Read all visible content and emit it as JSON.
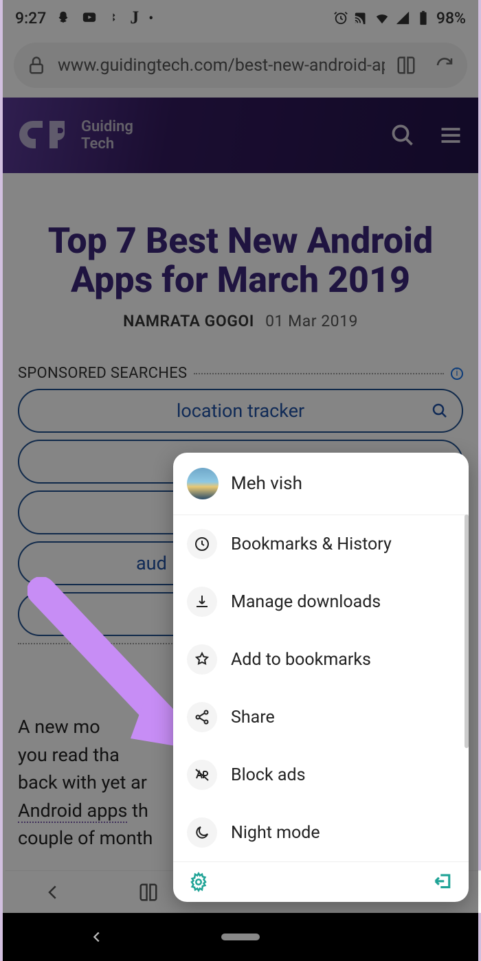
{
  "status": {
    "time": "9:27",
    "battery": "98%"
  },
  "url": "www.guidingtech.com/best-new-android-app",
  "brand": {
    "line1": "Guiding",
    "line2": "Tech"
  },
  "article": {
    "title": "Top 7 Best New Android Apps for March 2019",
    "author": "NAMRATA GOGOI",
    "date": "01 Mar 2019",
    "body_prefix": "A new mo",
    "body_line2": "you read tha",
    "body_line3": "back with yet ar",
    "body_underline": "Android apps",
    "body_line4": " th",
    "body_line5": "couple of month"
  },
  "sponsored": {
    "heading": "SPONSORED SEARCHES",
    "items": [
      "location tracker",
      "",
      "",
      "aud",
      ""
    ]
  },
  "menu": {
    "profile": "Meh vish",
    "items": [
      {
        "label": "Bookmarks & History"
      },
      {
        "label": "Manage downloads"
      },
      {
        "label": "Add to bookmarks"
      },
      {
        "label": "Share"
      },
      {
        "label": "Block ads"
      },
      {
        "label": "Night mode"
      }
    ]
  }
}
